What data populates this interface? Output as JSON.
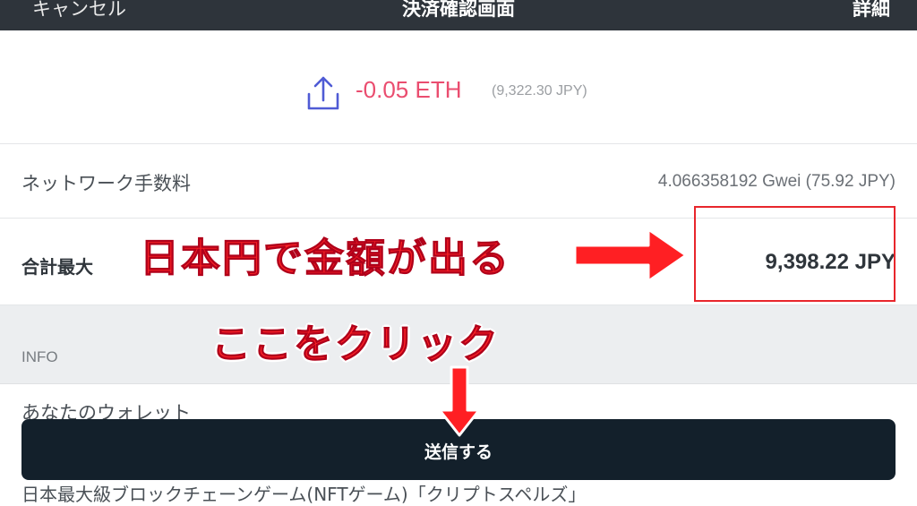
{
  "header": {
    "cancel_label": "キャンセル",
    "title": "決済確認画面",
    "detail_label": "詳細"
  },
  "amount": {
    "icon": "upload-icon",
    "eth_value": "-0.05 ETH",
    "jpy_value": "(9,322.30 JPY)"
  },
  "fee": {
    "label": "ネットワーク手数料",
    "value": "4.066358192 Gwei (75.92 JPY)"
  },
  "total": {
    "label": "合計最大",
    "value": "9,398.22 JPY"
  },
  "info": {
    "label": "INFO"
  },
  "wallet": {
    "label": "あなたのウォレット"
  },
  "send_button": {
    "label": "送信する"
  },
  "cut_off_text": "日本最大級ブロックチェーンゲーム(NFTゲーム)「クリプトスペルズ」",
  "annotations": {
    "yen_note": "日本円で金額が出る",
    "click_note": "ここをクリック",
    "accent_color": "#ff2326"
  },
  "colors": {
    "header_bg": "#2e343b",
    "eth_red": "#ea4d6f",
    "button_bg": "#13202b"
  }
}
